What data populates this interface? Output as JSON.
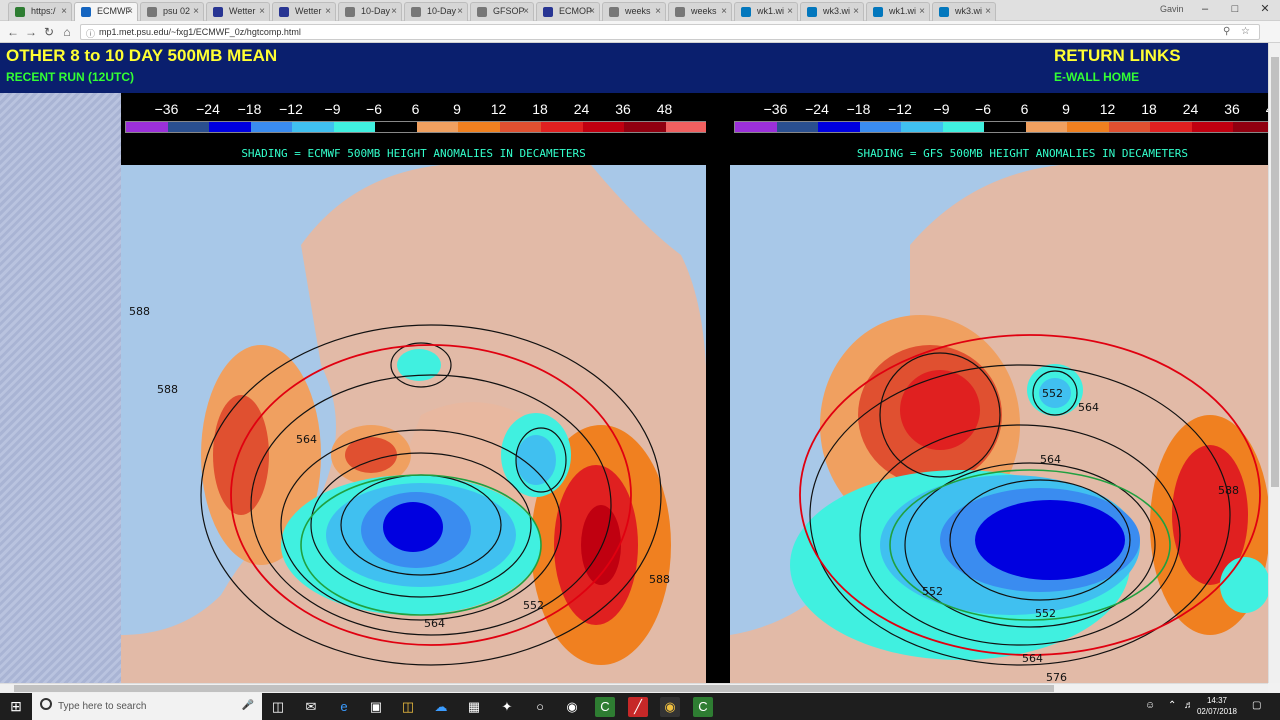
{
  "browser": {
    "tabs": [
      {
        "label": "https:/",
        "color": "#2e7d32"
      },
      {
        "label": "ECMWF",
        "color": "#1565c0",
        "active": true
      },
      {
        "label": "psu 02",
        "color": "#777777"
      },
      {
        "label": "Wetter",
        "color": "#283593"
      },
      {
        "label": "Wetter",
        "color": "#283593"
      },
      {
        "label": "10-Day",
        "color": "#777777"
      },
      {
        "label": "10-Day",
        "color": "#777777"
      },
      {
        "label": "GFSOP",
        "color": "#777777"
      },
      {
        "label": "ECMOP",
        "color": "#283593"
      },
      {
        "label": "weeks",
        "color": "#777777"
      },
      {
        "label": "weeks",
        "color": "#777777"
      },
      {
        "label": "wk1.wi",
        "color": "#0277bd"
      },
      {
        "label": "wk3.wi",
        "color": "#0277bd"
      },
      {
        "label": "wk1.wi",
        "color": "#0277bd"
      },
      {
        "label": "wk3.wi",
        "color": "#0277bd"
      }
    ],
    "user_label": "Gavin",
    "url": "mp1.met.psu.edu/~fxg1/ECMWF_0z/hgtcomp.html"
  },
  "page": {
    "title": "OTHER 8 to 10 DAY 500MB MEAN",
    "subtitle": "RECENT RUN (12UTC)",
    "return_links": "RETURN LINKS",
    "ewall_home": "E-WALL HOME"
  },
  "scale": {
    "labels": [
      "-36",
      "-24",
      "-18",
      "-12",
      "-9",
      "-6",
      "6",
      "9",
      "12",
      "18",
      "24",
      "36",
      "48"
    ],
    "colors": [
      "#9b30d9",
      "#2a4f8f",
      "#0000e0",
      "#3a8cf0",
      "#40c0f0",
      "#40f0e0",
      "#000000",
      "#f0a060",
      "#f08020",
      "#e05030",
      "#e02020",
      "#c00010",
      "#900010",
      "#f06060"
    ]
  },
  "panels": {
    "left_caption": "SHADING = ECMWF 500MB HEIGHT ANOMALIES IN DECAMETERS",
    "right_caption": "SHADING = GFS 500MB HEIGHT ANOMALIES IN DECAMETERS",
    "left_contours": [
      "588",
      "588",
      "564",
      "588",
      "564",
      "552"
    ],
    "right_contours": [
      "552",
      "564",
      "564",
      "552",
      "552",
      "564",
      "588",
      "576"
    ]
  },
  "taskbar": {
    "search_placeholder": "Type here to search",
    "time": "14:37",
    "date": "02/07/2018"
  }
}
